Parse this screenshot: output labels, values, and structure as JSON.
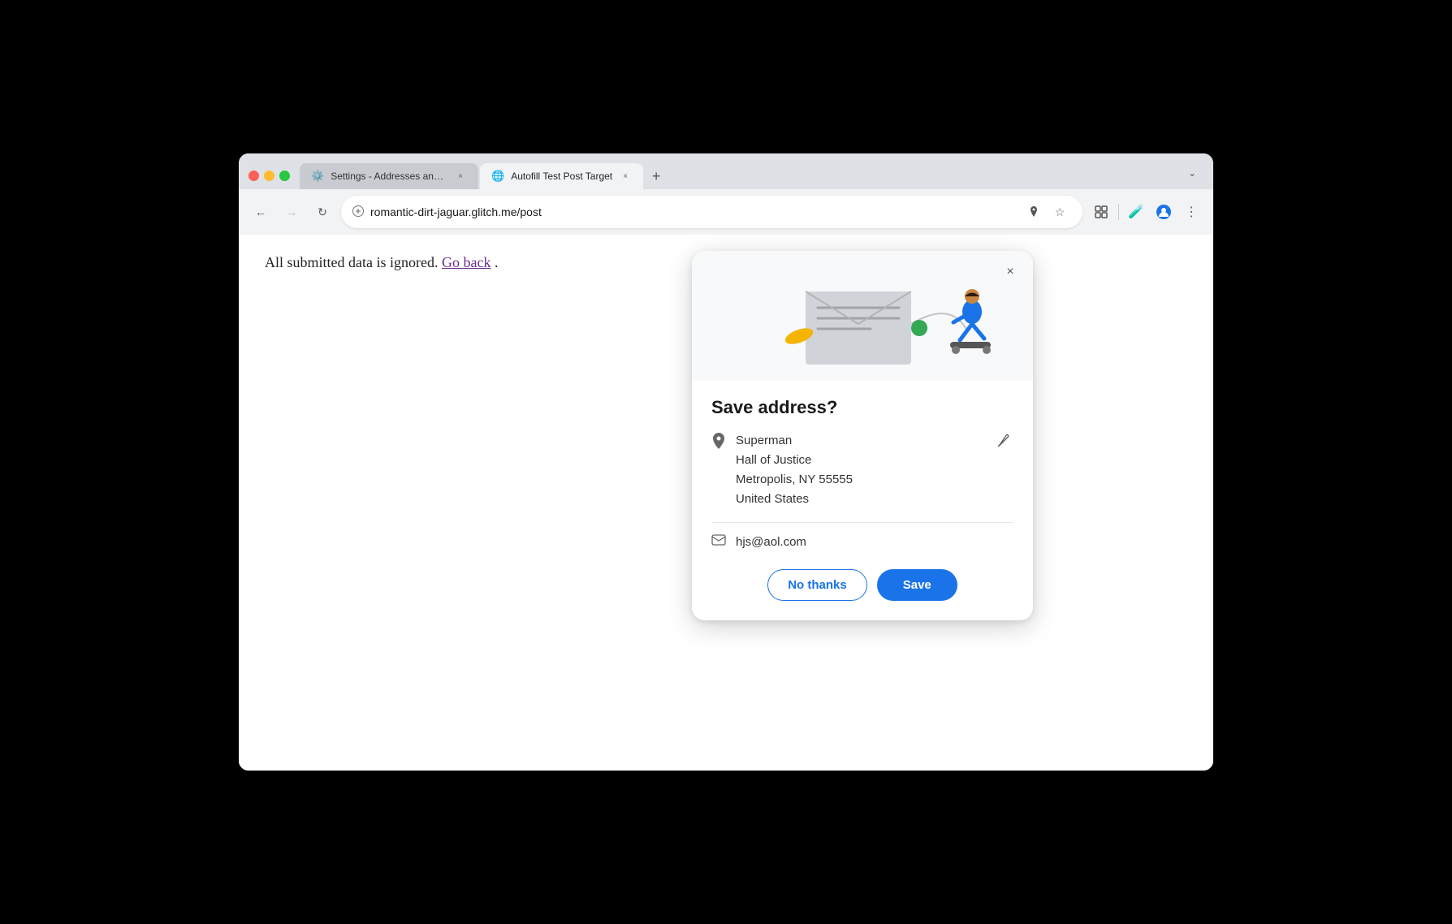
{
  "browser": {
    "tabs": [
      {
        "id": "settings-tab",
        "title": "Settings - Addresses and mo",
        "icon": "⚙️",
        "active": false
      },
      {
        "id": "autofill-tab",
        "title": "Autofill Test Post Target",
        "icon": "🌐",
        "active": true
      }
    ],
    "url": "romantic-dirt-jaguar.glitch.me/post",
    "nav": {
      "back_disabled": false,
      "forward_disabled": true
    }
  },
  "page": {
    "text": "All submitted data is ignored.",
    "link_text": "Go back",
    "period": "."
  },
  "popup": {
    "title": "Save address?",
    "close_label": "×",
    "address": {
      "name": "Superman",
      "line1": "Hall of Justice",
      "line2": "Metropolis, NY 55555",
      "line3": "United States"
    },
    "email": "hjs@aol.com",
    "buttons": {
      "no_thanks": "No thanks",
      "save": "Save"
    }
  },
  "icons": {
    "back": "←",
    "forward": "→",
    "reload": "↻",
    "location_pin": "📍",
    "star": "☆",
    "extensions": "🧩",
    "lab": "🧪",
    "profile": "👤",
    "more": "⋮",
    "dropdown": "⌄",
    "edit": "✏",
    "close": "×",
    "location": "📍",
    "email": "✉"
  }
}
